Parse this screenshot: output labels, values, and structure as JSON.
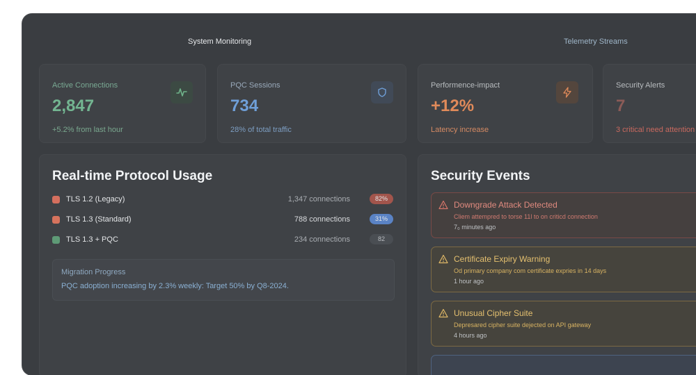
{
  "header": {
    "left_title": "System Monitoring",
    "right_title": "Telemetry Streams"
  },
  "cards": [
    {
      "title": "Active Connections",
      "value": "2,847",
      "sub": "+5.2% from last hour",
      "icon": "activity-icon",
      "color": "#6fb38a"
    },
    {
      "title": "PQC Sessions",
      "value": "734",
      "sub": "28% of total traffic",
      "icon": "shield-icon",
      "color": "#6f9fd8"
    },
    {
      "title": "Performence-impact",
      "value": "+12%",
      "sub": "Latency increase",
      "icon": "bolt-icon",
      "color": "#e08a5a"
    },
    {
      "title": "Security Alerts",
      "value": "7",
      "sub": "3 critical need attention",
      "icon": "alert-icon",
      "color": "#c9695f"
    }
  ],
  "protocol": {
    "title": "Real-time Protocol Usage",
    "rows": [
      {
        "label": "TLS 1.2 (Legacy)",
        "connections": "1,347 connections",
        "badge": "82%",
        "color": "#d46f5e",
        "badge_color": "#a2554c"
      },
      {
        "label": "TLS 1.3 (Standard)",
        "connections": "788 connections",
        "badge": "31%",
        "color": "#d6735d",
        "badge_color": "#5a83c5"
      },
      {
        "label": "TLS 1.3 + PQC",
        "connections": "234 connections",
        "badge": "82",
        "color": "#5e9a76",
        "badge_color": "#4a4e53"
      }
    ],
    "migration": {
      "title": "Migration Progress",
      "text": "PQC adoption increasing by 2.3% weekly: Target 50% by Q8-2024."
    }
  },
  "security": {
    "title": "Security Events",
    "events": [
      {
        "title": "Downgrade Attack Detected",
        "desc": "Cliem attempred to torse 11l to on criticd connection",
        "time": "7₀ minutes ago",
        "tone": "red"
      },
      {
        "title": "Certificate Expiry Warning",
        "desc": "Od primary company com certificate expries in 14 days",
        "time": "1 hour ago",
        "tone": "amber"
      },
      {
        "title": "Unusual  Cipher Suite",
        "desc": "Depresared cipher suite dejected on API gateway",
        "time": "4 hours ago",
        "tone": "amber"
      }
    ]
  }
}
